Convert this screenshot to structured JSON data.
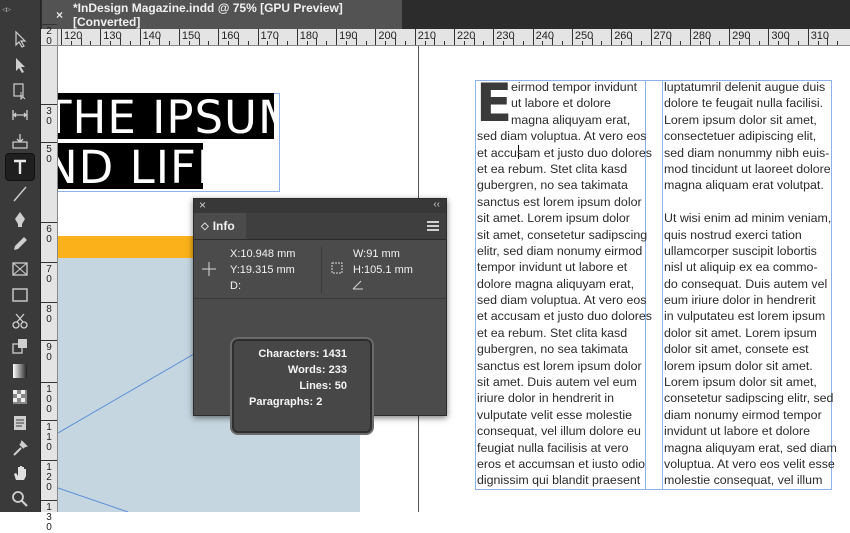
{
  "app": {
    "doc_tab_title": "*InDesign Magazine.indd @ 75% [GPU Preview] [Converted]",
    "close_glyph": "×",
    "toolbar_collapse_glyph": "◃▹"
  },
  "toolbar": {
    "tools": [
      {
        "name": "selection-tool",
        "icon": "arrow-outline-icon"
      },
      {
        "name": "direct-selection-tool",
        "icon": "arrow-filled-icon"
      },
      {
        "name": "page-tool",
        "icon": "page-icon"
      },
      {
        "name": "gap-tool",
        "icon": "gap-icon"
      },
      {
        "name": "content-collector-tool",
        "icon": "collector-icon"
      },
      {
        "name": "type-tool",
        "icon": "type-icon",
        "active": true
      },
      {
        "name": "line-tool",
        "icon": "line-icon"
      },
      {
        "name": "pen-tool",
        "icon": "pen-icon"
      },
      {
        "name": "pencil-tool",
        "icon": "pencil-icon"
      },
      {
        "name": "rectangle-frame-tool",
        "icon": "frame-icon"
      },
      {
        "name": "rectangle-tool",
        "icon": "rectangle-icon"
      },
      {
        "name": "scissors-tool",
        "icon": "scissors-icon"
      },
      {
        "name": "free-transform-tool",
        "icon": "transform-icon"
      },
      {
        "name": "gradient-swatch-tool",
        "icon": "gradient-icon"
      },
      {
        "name": "gradient-feather-tool",
        "icon": "feather-icon"
      },
      {
        "name": "note-tool",
        "icon": "note-icon"
      },
      {
        "name": "eyedropper-tool",
        "icon": "eyedropper-icon"
      },
      {
        "name": "hand-tool",
        "icon": "hand-icon"
      },
      {
        "name": "zoom-tool",
        "icon": "zoom-icon"
      }
    ]
  },
  "rulers": {
    "horizontal": [
      "120",
      "130",
      "140",
      "150",
      "160",
      "170",
      "180",
      "190",
      "200",
      "210",
      "220",
      "230",
      "240",
      "250",
      "260",
      "270",
      "280",
      "290",
      "300",
      "310"
    ],
    "vertical": [
      "20",
      "30",
      "50",
      "60",
      "70",
      "80",
      "90",
      "100",
      "110",
      "120",
      "130"
    ]
  },
  "canvas": {
    "headline_lines": [
      "THE IPSUM",
      "ND LIFE"
    ],
    "drop_cap": "E",
    "column1_lines": [
      "eirmod tempor invidunt",
      "ut labore et dolore",
      "magna aliquyam erat,",
      "sed diam voluptua. At vero eos",
      "et accusam et justo duo dolores",
      "et ea rebum. Stet clita kasd",
      "gubergren, no sea takimata",
      "sanctus est lorem ipsum dolor",
      "sit amet. Lorem ipsum dolor",
      "sit amet, consetetur sadipscing",
      "elitr,  sed diam nonumy eirmod",
      "tempor invidunt ut labore et",
      "dolore magna aliquyam erat,",
      "sed diam voluptua. At vero eos",
      "et accusam et justo duo dolores",
      "et ea rebum. Stet clita kasd",
      "gubergren, no sea takimata",
      "sanctus est lorem ipsum dolor",
      "sit amet. Duis autem vel eum",
      "iriure dolor in hendrerit in",
      "vulputate velit esse molestie",
      "consequat, vel illum dolore eu",
      "feugiat nulla facilisis at vero",
      "eros et accumsan et iusto odio",
      "dignissim qui blandit praesent"
    ],
    "column2_lines": [
      "luptatumril delenit augue duis",
      "dolore te feugait nulla facilisi.",
      "Lorem ipsum dolor sit amet,",
      "consectetuer adipiscing elit,",
      "sed diam nonummy nibh euis-",
      "mod tincidunt ut laoreet dolore",
      "magna aliquam erat volutpat.",
      "",
      "Ut wisi enim ad minim veniam,",
      "quis nostrud exerci tation",
      "ullamcorper suscipit lobortis",
      "nisl ut aliquip ex ea commo-",
      "do consequat. Duis autem vel",
      "eum iriure dolor in hendrerit",
      "in vulputateu est lorem ipsum",
      "dolor sit amet. Lorem ipsum",
      "dolor sit amet, consete est",
      "lorem ipsum dolor sit amet.",
      "Lorem ipsum dolor sit amet,",
      "consetetur sadipscing elitr,  sed",
      "diam nonumy eirmod tempor",
      "invidunt ut labore et dolore",
      "magna aliquyam erat, sed diam",
      "voluptua. At vero eos velit esse",
      "molestie consequat, vel illum"
    ],
    "colors": {
      "orange_bar": "#fbb21a",
      "blue_panel": "#c6d6e0",
      "frame_edge": "#8db4e8",
      "headline_bg": "#000000"
    }
  },
  "info_panel": {
    "tab_label": "Info",
    "tab_glyph": "◇",
    "collapse_glyph": "‹‹",
    "x": "X:10.948 mm",
    "y": "Y:19.315 mm",
    "d": "D:",
    "w": "W:91 mm",
    "h": "H:105.1 mm",
    "stats": {
      "characters": "Characters: 1431",
      "words": "Words: 233",
      "lines": "Lines: 50",
      "paragraphs": "Paragraphs: 2"
    }
  }
}
